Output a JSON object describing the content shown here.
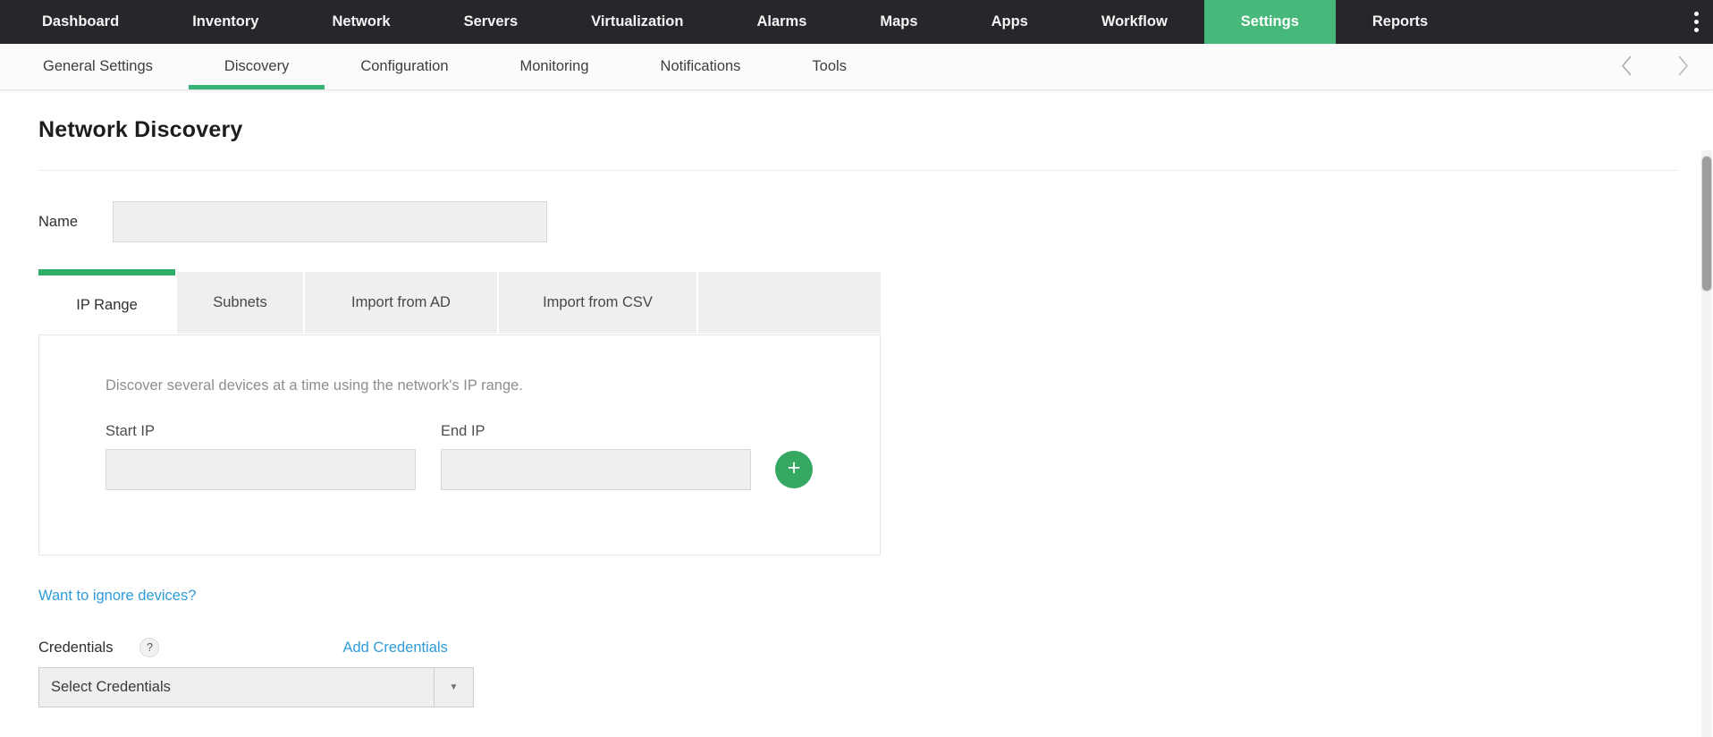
{
  "colors": {
    "nav_background": "#26272a",
    "nav_active_green": "#45b87a",
    "accent_green": "#2fae68",
    "button_green": "#35a862",
    "link_blue": "#2f9bd8",
    "input_gray": "#efefef"
  },
  "topnav": {
    "items": [
      {
        "label": "Dashboard",
        "active": false
      },
      {
        "label": "Inventory",
        "active": false
      },
      {
        "label": "Network",
        "active": false
      },
      {
        "label": "Servers",
        "active": false
      },
      {
        "label": "Virtualization",
        "active": false
      },
      {
        "label": "Alarms",
        "active": false
      },
      {
        "label": "Maps",
        "active": false
      },
      {
        "label": "Apps",
        "active": false
      },
      {
        "label": "Workflow",
        "active": false
      },
      {
        "label": "Settings",
        "active": true
      },
      {
        "label": "Reports",
        "active": false
      }
    ],
    "kebab_icon": "kebab-menu"
  },
  "subnav": {
    "items": [
      {
        "label": "General Settings",
        "active": false
      },
      {
        "label": "Discovery",
        "active": true
      },
      {
        "label": "Configuration",
        "active": false
      },
      {
        "label": "Monitoring",
        "active": false
      },
      {
        "label": "Notifications",
        "active": false
      },
      {
        "label": "Tools",
        "active": false
      }
    ],
    "prev_icon": "chevron-left",
    "next_icon": "chevron-right"
  },
  "content": {
    "title": "Network Discovery",
    "name_field": {
      "label": "Name",
      "value": ""
    },
    "tabs": [
      {
        "label": "IP Range",
        "active": true
      },
      {
        "label": "Subnets",
        "active": false
      },
      {
        "label": "Import from AD",
        "active": false
      },
      {
        "label": "Import from CSV",
        "active": false
      }
    ],
    "ip_range_panel": {
      "description": "Discover several devices at a time using the network's IP range.",
      "start_ip": {
        "label": "Start IP",
        "value": ""
      },
      "end_ip": {
        "label": "End IP",
        "value": ""
      },
      "add_button_label": "+"
    },
    "ignore_devices_link": "Want to ignore devices?",
    "credentials": {
      "label": "Credentials",
      "help_badge": "?",
      "add_link": "Add Credentials",
      "selected_value": "Select Credentials",
      "caret_icon": "▼"
    }
  }
}
